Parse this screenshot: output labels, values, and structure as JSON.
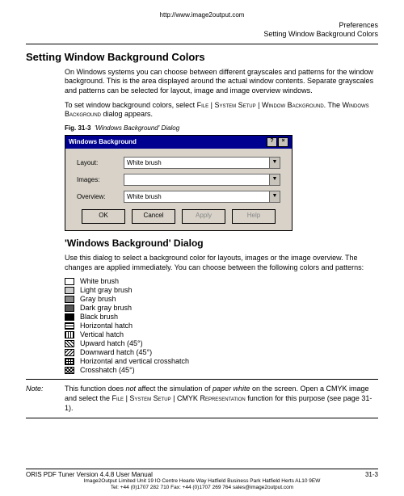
{
  "url": "http://www.image2output.com",
  "header": {
    "line1": "Preferences",
    "line2": "Setting Window Background Colors"
  },
  "h1": "Setting Window Background Colors",
  "para1": "On Windows systems you can choose between different grayscales and patterns for the window background. This is the area displayed around the actual window contents. Separate grayscales and patterns can be selected for layout, image and image overview windows.",
  "para2a": "To set window background colors, select ",
  "para2b": "File",
  "para2c": " | ",
  "para2d": "System Setup",
  "para2e": " | ",
  "para2f": "Window Background",
  "para2g": ". The ",
  "para2h": "Windows Background",
  "para2i": " dialog appears.",
  "fig": {
    "label": "Fig. 31-3",
    "title": "'Windows Background' Dialog"
  },
  "dialog": {
    "title": "Windows Background",
    "rows": [
      {
        "label": "Layout:",
        "value": "White brush"
      },
      {
        "label": "Images:",
        "value": ""
      },
      {
        "label": "Overview:",
        "value": "White brush"
      }
    ],
    "buttons": {
      "ok": "OK",
      "cancel": "Cancel",
      "apply": "Apply",
      "help": "Help"
    }
  },
  "h2": "'Windows Background' Dialog",
  "para3": "Use this dialog to select a background color for layouts, images or the image overview. The changes are applied immediately. You can choose between the following colors and patterns:",
  "swatches": [
    "White brush",
    "Light gray brush",
    "Gray brush",
    "Dark gray brush",
    "Black brush",
    "Horizontal hatch",
    "Vertical hatch",
    "Upward hatch (45°)",
    "Downward hatch (45°)",
    "Horizontal and vertical crosshatch",
    "Crosshatch (45°)"
  ],
  "note": {
    "label": "Note:",
    "t1": "This function does ",
    "t1i": "not",
    "t2": " affect the simulation of ",
    "t2i": "paper white",
    "t3": " on the screen. Open a CMYK image and select the ",
    "sc1": "File",
    "sep": " | ",
    "sc2": "System Setup",
    "sc3": "CMYK Re­presentation",
    "t4": " function for this purpose (see page 31-1)."
  },
  "footer": {
    "left": "ORIS PDF Tuner Version 4.4.8   User Manual",
    "right": "31-3",
    "fine1": "Image2Output Limited  Unit 19 IO Centre Hearle Way Hatfield Business Park Hatfield Herts AL10 9EW",
    "fine2": "Tel: +44 (0)1707 282 710 Fax: +44 (0)1707 269 764 sales@image2output.com"
  }
}
